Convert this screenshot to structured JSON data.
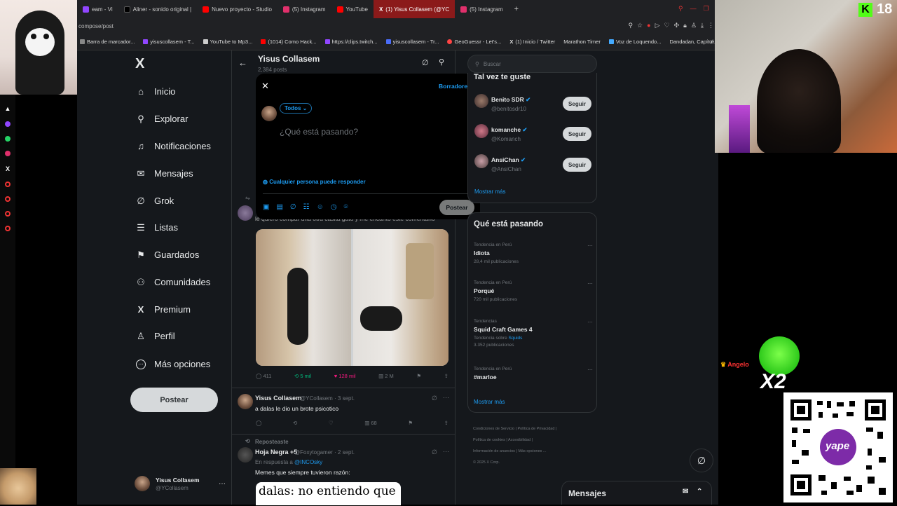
{
  "browser": {
    "tabs": [
      {
        "label": "eam - Vi",
        "color": "#9146ff"
      },
      {
        "label": "Aliner - sonido original |",
        "color": "#000000"
      },
      {
        "label": "Nuevo proyecto - Studio",
        "color": "#ff0000"
      },
      {
        "label": "(5) Instagram",
        "color": "#e1306c"
      },
      {
        "label": "YouTube",
        "color": "#ff0000"
      },
      {
        "label": "(1) Yisus Collasem (@YC",
        "color": "#000000",
        "active": true
      },
      {
        "label": "(5) Instagram",
        "color": "#e1306c"
      }
    ],
    "new_tab": "+",
    "address": "compose/post",
    "bookmarks": [
      {
        "label": "Barra de marcador...",
        "color": "#888888"
      },
      {
        "label": "yisuscollasem - T...",
        "color": "#9146ff"
      },
      {
        "label": "YouTube to Mp3...",
        "color": "#cccccc"
      },
      {
        "label": "(1014) Como Hack...",
        "color": "#ff0000"
      },
      {
        "label": "https://clips.twitch...",
        "color": "#9146ff"
      },
      {
        "label": "yisuscollasem - Tr...",
        "color": "#4a6cf7"
      },
      {
        "label": "GeoGuessr - Let's...",
        "color": "#ff4444"
      },
      {
        "label": "(1) Inicio / Twitter",
        "color": "#000000"
      },
      {
        "label": "Marathon Timer",
        "color": "#202124"
      },
      {
        "label": "Voz de Loquendo...",
        "color": "#44aaff"
      },
      {
        "label": "Dandadan, Capítul...",
        "color": "#202124"
      }
    ]
  },
  "stream": {
    "viewer_count": "18",
    "chat_user": "Angelo",
    "multiplier": "X2"
  },
  "nav": {
    "items": [
      {
        "label": "Inicio",
        "icon": "home-icon",
        "glyph": "⌂"
      },
      {
        "label": "Explorar",
        "icon": "search-icon",
        "glyph": "⚲"
      },
      {
        "label": "Notificaciones",
        "icon": "bell-icon",
        "glyph": "♫"
      },
      {
        "label": "Mensajes",
        "icon": "mail-icon",
        "glyph": "✉"
      },
      {
        "label": "Grok",
        "icon": "grok-icon",
        "glyph": "∅"
      },
      {
        "label": "Listas",
        "icon": "list-icon",
        "glyph": "☰"
      },
      {
        "label": "Guardados",
        "icon": "bookmark-icon",
        "glyph": "⚑"
      },
      {
        "label": "Comunidades",
        "icon": "communities-icon",
        "glyph": "⚇"
      },
      {
        "label": "Premium",
        "icon": "x-premium-icon",
        "glyph": "X"
      },
      {
        "label": "Perfil",
        "icon": "profile-icon",
        "glyph": "♙"
      },
      {
        "label": "Más opciones",
        "icon": "more-icon",
        "glyph": "⋯"
      }
    ],
    "post_button": "Postear",
    "profile_name": "Yisus Collasem",
    "profile_handle": "@YCollasem"
  },
  "header": {
    "title": "Yisus Collasem",
    "posts": "2,384 posts"
  },
  "compose": {
    "drafts": "Borradores",
    "audience": "Todos",
    "placeholder": "¿Qué está pasando?",
    "reply_setting": "Cualquier persona puede responder",
    "post_button": "Postear"
  },
  "tweets": [
    {
      "text": "le quiero compar una otra casita gato y me encanto este comentario",
      "replies": "411",
      "reposts": "5 mil",
      "likes": "128 mil",
      "views": "2 M"
    },
    {
      "name": "Yisus Collasem",
      "handle": "@YCollasem · 3 sept.",
      "text": "a dalas le dio un brote psicotico",
      "views": "68"
    },
    {
      "repost_label": "Reposteaste",
      "name": "Hoja Negra +5",
      "handle": "@Foxytogamer · 2 sept.",
      "reply_to_prefix": "En respuesta a",
      "reply_to": "@INCOsky",
      "text": "Memes que siempre tuvieron razón:",
      "meme_text": "dalas: no entiendo que"
    }
  ],
  "right": {
    "search_placeholder": "Buscar",
    "who_to_follow_title": "Tal vez te guste",
    "suggestions": [
      {
        "name": "Benito SDR",
        "handle": "@benitosdr10"
      },
      {
        "name": "komanche",
        "handle": "@Komanch"
      },
      {
        "name": "AnsiChan",
        "handle": "@AnsiChan"
      }
    ],
    "follow_label": "Seguir",
    "show_more": "Mostrar más",
    "trends_title": "Qué está pasando",
    "trends": [
      {
        "category": "Tendencia en Perú",
        "name": "Idiota",
        "count": "28,4 mil publicaciones"
      },
      {
        "category": "Tendencia en Perú",
        "name": "Porqué",
        "count": "720 mil publicaciones"
      },
      {
        "category": "Tendencias",
        "name": "Squid Craft Games 4",
        "count_prefix": "Tendencia sobre",
        "count_link": "Squids",
        "count": "3.352 publicaciones"
      },
      {
        "category": "Tendencia en Perú",
        "name": "#marloe",
        "count": ""
      }
    ],
    "footer_links": [
      "Condiciones de Servicio",
      "Política de Privacidad",
      "Política de cookies",
      "Accesibilidad",
      "Información de anuncios",
      "Más opciones ...",
      "© 2025 X Corp."
    ],
    "messages_label": "Mensajes"
  },
  "colors": {
    "accent": "#1d9bf0",
    "like": "#f91880",
    "repost": "#00ba7c",
    "kick": "#53fc18"
  }
}
